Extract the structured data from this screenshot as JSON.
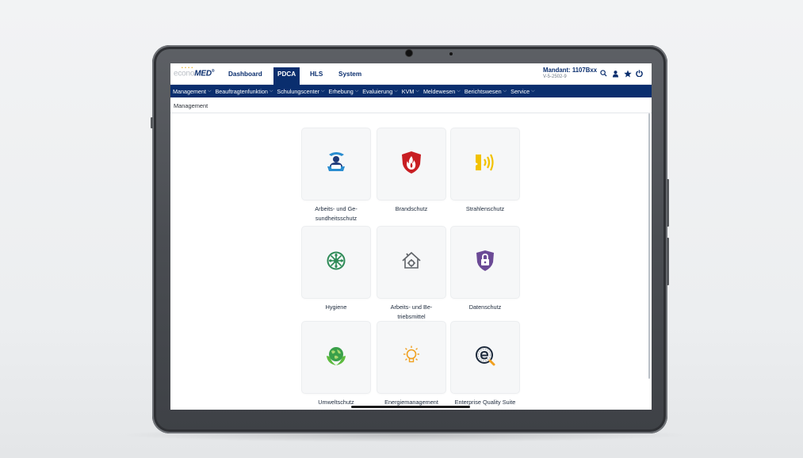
{
  "header": {
    "logo_part1": "econo",
    "logo_part2": "MED",
    "logo_mark": "®",
    "tabs": [
      "Dashboard",
      "PDCA",
      "HLS",
      "System"
    ],
    "active_tab": "PDCA",
    "mandant": "Mandant: 1107Bxx",
    "version": "V-5-2502-9"
  },
  "icons": {
    "search": "search-icon",
    "user": "user-icon",
    "star": "star-icon",
    "power": "power-icon"
  },
  "nav": {
    "items": [
      "Management",
      "Beauftragtenfunktion",
      "Schulungscenter",
      "Erhebung",
      "Evaluierung",
      "KVM",
      "Meldewesen",
      "Berichtswesen",
      "Service"
    ]
  },
  "breadcrumb": "Management",
  "tiles": [
    {
      "label": "Arbeits- und Ge-\nsundheitsschutz",
      "icon": "occupational-safety-icon"
    },
    {
      "label": "Brandschutz",
      "icon": "fire-shield-icon"
    },
    {
      "label": "Strahlenschutz",
      "icon": "radiation-icon"
    },
    {
      "label": "Hygiene",
      "icon": "hygiene-icon"
    },
    {
      "label": "Arbeits- und Be-\ntriebsmittel",
      "icon": "equipment-icon"
    },
    {
      "label": "Datenschutz",
      "icon": "data-lock-shield-icon"
    },
    {
      "label": "Umweltschutz",
      "icon": "globe-hands-icon"
    },
    {
      "label": "Energiemanagement",
      "icon": "lightbulb-icon"
    },
    {
      "label": "Enterprise Quality Suite",
      "icon": "eqs-logo-icon"
    }
  ],
  "colors": {
    "brand_navy": "#0a2e6e",
    "fire_red": "#c81e23",
    "radiation_yellow": "#f2c200",
    "hygiene_green": "#2e8b57",
    "privacy_purple": "#6b4a96",
    "energy_orange": "#f0a020"
  }
}
